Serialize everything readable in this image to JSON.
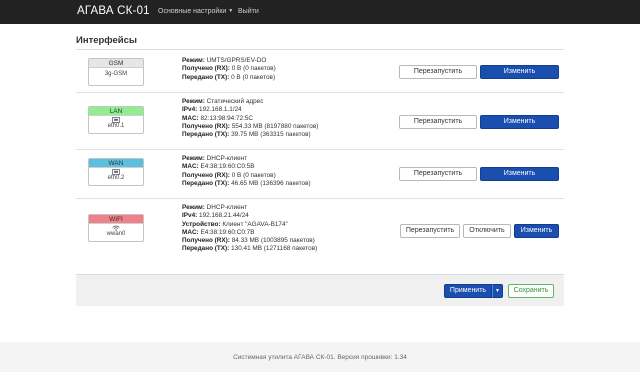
{
  "colors": {
    "gsm": "#e6e6e6",
    "lan": "#90ee90",
    "wan": "#5bc0de",
    "wifi": "#f0808a",
    "primary": "#1a4fb0"
  },
  "navbar": {
    "brand": "АГАВА СК-01",
    "menu": [
      "Основные настройки",
      "Выйти"
    ]
  },
  "page": {
    "title": "Интерфейсы"
  },
  "interfaces": [
    {
      "name": "GSM",
      "icon": "",
      "device": "3g-GSM",
      "info": [
        {
          "label": "Режим:",
          "value": " UMTS/GPRS/EV-DO"
        },
        {
          "label": "Получено (RX):",
          "value": " 0 В (0 пакетов)"
        },
        {
          "label": "Передано (TX):",
          "value": " 0 В (0 пакетов)"
        }
      ],
      "buttons": [
        "Перезапустить",
        "Изменить"
      ]
    },
    {
      "name": "LAN",
      "icon": "ethernet-icon",
      "device": "eth0.1",
      "info": [
        {
          "label": "Режим:",
          "value": " Статический адрес"
        },
        {
          "label": "IPv4:",
          "value": " 192.168.1.1/24"
        },
        {
          "label": "MAC:",
          "value": " 82:13:98:94:72:5C"
        },
        {
          "label": "Получено (RX):",
          "value": " 554.33 MB (8197880 пакетов)"
        },
        {
          "label": "Передано (TX):",
          "value": " 39.75 MB (363315 пакетов)"
        }
      ],
      "buttons": [
        "Перезапустить",
        "Изменить"
      ]
    },
    {
      "name": "WAN",
      "icon": "ethernet-icon",
      "device": "eth0.2",
      "info": [
        {
          "label": "Режим:",
          "value": " DHCP-клиент"
        },
        {
          "label": "MAC:",
          "value": " E4:38:19:60:C0:5B"
        },
        {
          "label": "Получено (RX):",
          "value": " 0 В (0 пакетов)"
        },
        {
          "label": "Передано (TX):",
          "value": " 46.65 MB (136396 пакетов)"
        }
      ],
      "buttons": [
        "Перезапустить",
        "Изменить"
      ]
    },
    {
      "name": "WIFI",
      "icon": "wifi-icon",
      "device": "wwan0",
      "info": [
        {
          "label": "Режим:",
          "value": " DHCP-клиент"
        },
        {
          "label": "IPv4:",
          "value": " 192.168.21.44/24"
        },
        {
          "label": "Устройство:",
          "value": " Клиент \"AGAVA-B174\""
        },
        {
          "label": "MAC:",
          "value": " E4:38:19:60:C0:7B"
        },
        {
          "label": "Получено (RX):",
          "value": " 84.33 MB (1003895 пакетов)"
        },
        {
          "label": "Передано (TX):",
          "value": " 130.41 MB (1271168 пакетов)"
        }
      ],
      "buttons": [
        "Перезапустить",
        "Отключить",
        "Изменить"
      ]
    }
  ],
  "actions": {
    "apply": "Применить",
    "save": "Сохранить"
  },
  "footer": {
    "text": "Системная утилита АГАВА СК-01. Версия прошивки: 1.34"
  }
}
